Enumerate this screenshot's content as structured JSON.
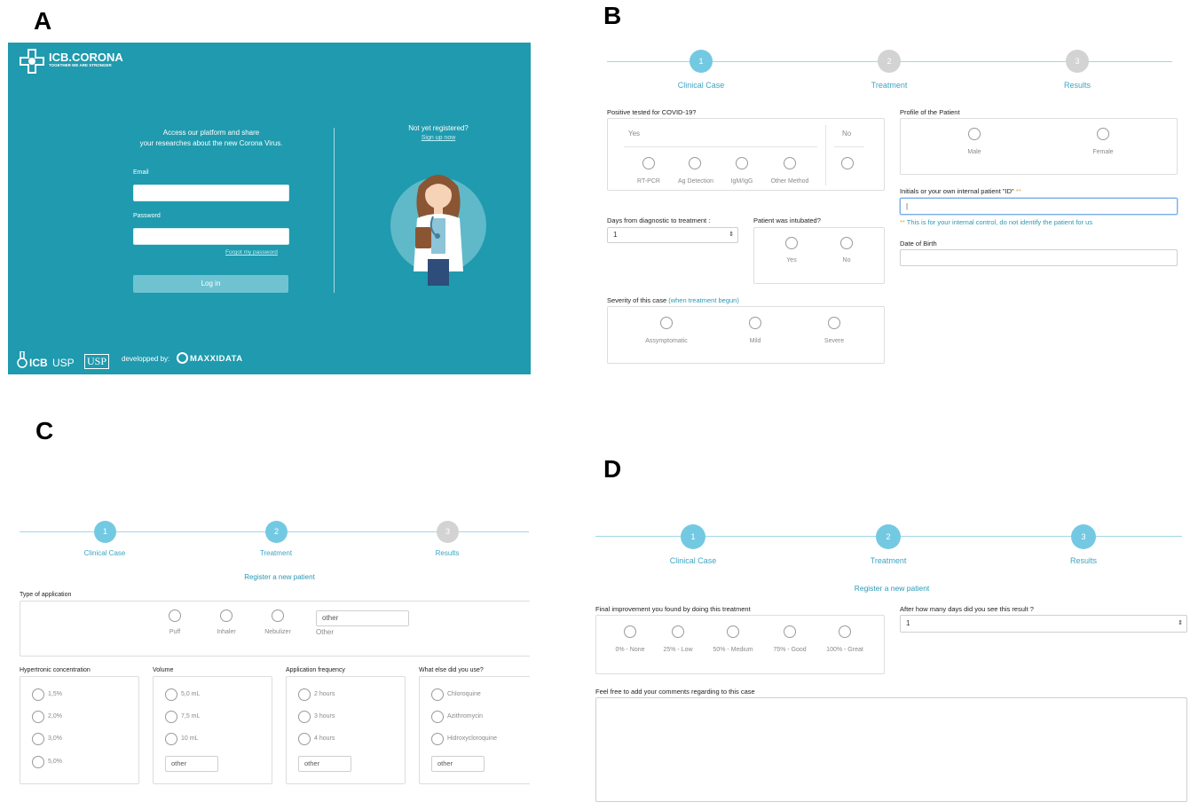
{
  "panel_letters": {
    "a": "A",
    "b": "B",
    "c": "C",
    "d": "D"
  },
  "colors": {
    "brand_teal": "#1f9aae",
    "step_active": "#74c9e2",
    "step_inactive": "#d3d3d3",
    "accent_link": "#2a98b6"
  },
  "panel_a": {
    "logo_title": "ICB.CORONA",
    "logo_tagline": "TOGETHER WE ARE STRONGER",
    "intro_line1": "Access our platform and share",
    "intro_line2": "your researches about the new Corona Virus.",
    "email_label": "Email",
    "password_label": "Password",
    "forgot_link": "Forgot my password",
    "login_button": "Log in",
    "not_registered": "Not yet registered?",
    "signup_link": "Sign up now",
    "footer_icb": "ICB",
    "footer_usp": "USP",
    "footer_usp_logo": "USP",
    "footer_developed": "developped by:",
    "footer_maxxidata": "MAXXIDATA",
    "icons": [
      "logo-cross-icon",
      "doctor-illustration",
      "icb-flask-icon",
      "maxxidata-logo-icon"
    ]
  },
  "stepper": {
    "steps": [
      {
        "number": "1",
        "label": "Clinical Case"
      },
      {
        "number": "2",
        "label": "Treatment"
      },
      {
        "number": "3",
        "label": "Results"
      }
    ]
  },
  "panel_b": {
    "covid_question": "Positive tested for COVID-19?",
    "yes": "Yes",
    "no": "No",
    "methods": [
      "RT-PCR",
      "Ag Detection",
      "IgM/IgG",
      "Other Method"
    ],
    "profile_label": "Profile of the Patient",
    "sex_options": [
      "Male",
      "Female"
    ],
    "initials_label": "Initials or your own internal patient \"ID\"",
    "required_mark": "**",
    "initials_value": "|",
    "initials_hint": "This is for your internal control, do not identify the patient for us",
    "days_label": "Days from diagnostic to treatment :",
    "days_value": "1",
    "intubated_label": "Patient was intubated?",
    "intubated_options": [
      "Yes",
      "No"
    ],
    "dob_label": "Date of Birth",
    "severity_label": "Severity of this case",
    "severity_hint": "(when treatment begun)",
    "severity_options": [
      "Assymptomatic",
      "Mild",
      "Severe"
    ]
  },
  "panel_c": {
    "register_title": "Register a new patient",
    "type_label": "Type of application",
    "application_options": [
      "Puff",
      "Inhaler",
      "Nebulizer"
    ],
    "other_placeholder": "other",
    "other_label": "Other",
    "concentration_label": "Hypertronic concentration",
    "concentration_options": [
      "1,5%",
      "2,0%",
      "3,0%",
      "5,0%"
    ],
    "volume_label": "Volume",
    "volume_options": [
      "5,0 mL",
      "7,5 mL",
      "10 mL"
    ],
    "frequency_label": "Application frequency",
    "frequency_options": [
      "2 hours",
      "3 hours",
      "4 hours"
    ],
    "else_label": "What else did you use?",
    "else_options": [
      "Chloroquine",
      "Azithromycin",
      "Hidroxycloroquine"
    ]
  },
  "panel_d": {
    "register_title": "Register a new patient",
    "improvement_label": "Final improvement you found by doing this treatment",
    "improvement_options": [
      "0% - None",
      "25% - Low",
      "50% - Medium",
      "75% - Good",
      "100% - Great"
    ],
    "days_label": "After how many days did you see this result ?",
    "days_value": "1",
    "comments_label": "Feel free to add your comments regarding to this case"
  }
}
